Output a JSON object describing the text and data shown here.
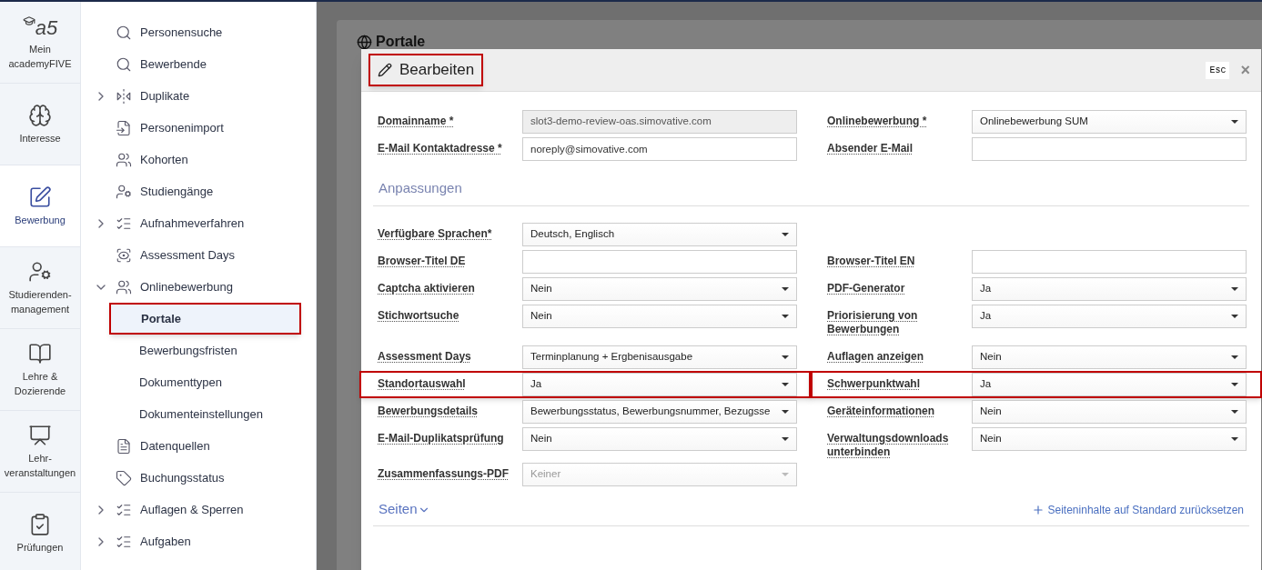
{
  "rail": {
    "logo": "a5",
    "items": [
      {
        "label": "Mein academyFIVE",
        "selected": false
      },
      {
        "label": "Interesse",
        "selected": false
      },
      {
        "label": "Bewerbung",
        "selected": true
      },
      {
        "label": "Studierenden-management",
        "selected": false
      },
      {
        "label": "Lehre & Dozierende",
        "selected": false
      },
      {
        "label": "Lehr-veranstaltungen",
        "selected": false
      },
      {
        "label": "Prüfungen",
        "selected": false
      }
    ]
  },
  "nav": {
    "items": [
      {
        "label": "Personensuche",
        "kind": "link"
      },
      {
        "label": "Bewerbende",
        "kind": "link"
      },
      {
        "label": "Duplikate",
        "kind": "group",
        "expanded": false
      },
      {
        "label": "Personenimport",
        "kind": "link"
      },
      {
        "label": "Kohorten",
        "kind": "link"
      },
      {
        "label": "Studiengänge",
        "kind": "link"
      },
      {
        "label": "Aufnahmeverfahren",
        "kind": "group",
        "expanded": false
      },
      {
        "label": "Assessment Days",
        "kind": "link"
      },
      {
        "label": "Onlinebewerbung",
        "kind": "group",
        "expanded": true,
        "children": [
          {
            "label": "Portale",
            "selected": true,
            "highlighted": true
          },
          {
            "label": "Bewerbungsfristen",
            "selected": false,
            "highlighted": false
          },
          {
            "label": "Dokumenttypen",
            "selected": false,
            "highlighted": false
          },
          {
            "label": "Dokumenteinstellungen",
            "selected": false,
            "highlighted": false
          }
        ]
      },
      {
        "label": "Datenquellen",
        "kind": "link"
      },
      {
        "label": "Buchungsstatus",
        "kind": "link"
      },
      {
        "label": "Auflagen & Sperren",
        "kind": "group",
        "expanded": false
      },
      {
        "label": "Aufgaben",
        "kind": "group",
        "expanded": false
      }
    ]
  },
  "page": {
    "title": "Portale"
  },
  "dialog": {
    "title": "Bearbeiten",
    "title_highlighted": true,
    "esc_key": "Esc",
    "close": "×",
    "top_rows": [
      [
        {
          "label": "Domainname *",
          "kind": "readonly",
          "value": "slot3-demo-review-oas.simovative.com",
          "highlighted": false
        },
        {
          "label": "Onlinebewerbung *",
          "kind": "select",
          "value": "Onlinebewerbung SUM",
          "highlighted": false
        }
      ],
      [
        {
          "label": "E-Mail Kontaktadresse *",
          "kind": "text",
          "value": "noreply@simovative.com",
          "highlighted": false
        },
        {
          "label": "Absender E-Mail",
          "kind": "text",
          "highlighted": false
        }
      ]
    ],
    "section": "Anpassungen",
    "rows": [
      [
        {
          "label": "Verfügbare Sprachen*",
          "kind": "select",
          "value": "Deutsch, Englisch",
          "highlighted": false
        }
      ],
      [
        {
          "label": "Browser-Titel DE",
          "kind": "text",
          "highlighted": false
        },
        {
          "label": "Browser-Titel EN",
          "kind": "text",
          "highlighted": false
        }
      ],
      [
        {
          "label": "Captcha aktivieren",
          "kind": "select",
          "value": "Nein",
          "highlighted": false
        },
        {
          "label": "PDF-Generator",
          "kind": "select",
          "value": "Ja",
          "highlighted": false
        }
      ],
      [
        {
          "label": "Stichwortsuche",
          "kind": "select",
          "value": "Nein",
          "highlighted": false
        },
        {
          "label": "Priorisierung von Bewerbungen",
          "kind": "select",
          "value": "Ja",
          "highlighted": false
        }
      ],
      [
        {
          "label": "Assessment Days",
          "kind": "select",
          "value": "Terminplanung + Ergbenisausgabe",
          "highlighted": false
        },
        {
          "label": "Auflagen anzeigen",
          "kind": "select",
          "value": "Nein",
          "highlighted": false
        }
      ],
      [
        {
          "label": "Standortauswahl",
          "kind": "select",
          "value": "Ja",
          "highlighted": true
        },
        {
          "label": "Schwerpunktwahl",
          "kind": "select",
          "value": "Ja",
          "highlighted": true
        }
      ],
      [
        {
          "label": "Bewerbungsdetails",
          "kind": "select",
          "value": "Bewerbungsstatus, Bewerbungsnummer, Bezugsse",
          "highlighted": false
        },
        {
          "label": "Geräteinformationen",
          "kind": "select",
          "value": "Nein",
          "highlighted": false
        }
      ],
      [
        {
          "label": "E-Mail-Duplikatsprüfung",
          "kind": "select",
          "value": "Nein",
          "highlighted": false
        },
        {
          "label": "Verwaltungsdownloads unterbinden",
          "kind": "select",
          "value": "Nein",
          "highlighted": false
        }
      ],
      [
        {
          "label": "Zusammenfassungs-PDF",
          "kind": "select",
          "value": "Keiner",
          "disabled": true,
          "highlighted": false
        }
      ]
    ],
    "pages_section": {
      "label": "Seiten",
      "expanded": false,
      "reset_link": "Seiteninhalte auf Standard zurücksetzen"
    }
  }
}
